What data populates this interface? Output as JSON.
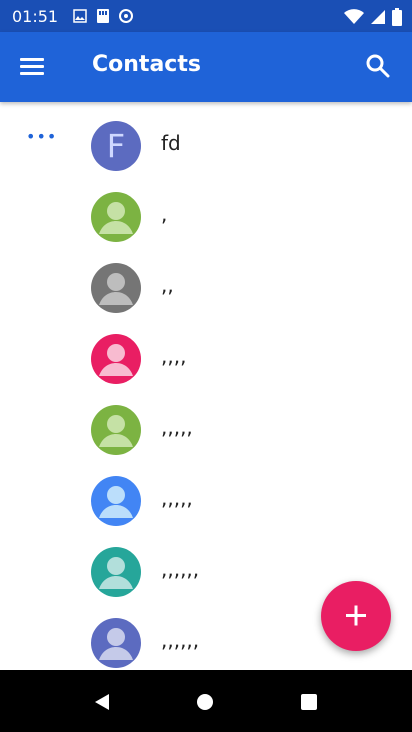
{
  "status_bar": {
    "time": "01:51",
    "left_icons": [
      "photos-icon",
      "storage-icon",
      "data-saver-icon"
    ],
    "right_icons": [
      "wifi-icon",
      "signal-icon",
      "battery-icon"
    ]
  },
  "app_bar": {
    "title": "Contacts",
    "menu_icon": "hamburger-menu-icon",
    "search_icon": "search-icon"
  },
  "contacts": [
    {
      "name": "fd",
      "avatar_type": "letter",
      "letter": "F",
      "color": "#5c6bc0"
    },
    {
      "name": ",",
      "avatar_type": "person",
      "color": "#7cb342"
    },
    {
      "name": ",,",
      "avatar_type": "person",
      "color": "#757575"
    },
    {
      "name": ",,,,",
      "avatar_type": "person",
      "color": "#e91e63"
    },
    {
      "name": ",,,,,",
      "avatar_type": "person",
      "color": "#7cb342"
    },
    {
      "name": ",,,,,",
      "avatar_type": "person",
      "color": "#4285f4"
    },
    {
      "name": ",,,,,,",
      "avatar_type": "person",
      "color": "#26a69a"
    },
    {
      "name": ",,,,,,",
      "avatar_type": "person",
      "color": "#5c6bc0"
    }
  ],
  "more_icon": "more-horiz-icon",
  "fab": {
    "icon": "add-icon",
    "color": "#e91e63"
  },
  "nav_bar": {
    "back": "back-icon",
    "home": "home-icon",
    "recents": "recents-icon"
  },
  "colors": {
    "status_bar": "#1a4fb5",
    "app_bar": "#1f63d8",
    "accent": "#e91e63"
  }
}
